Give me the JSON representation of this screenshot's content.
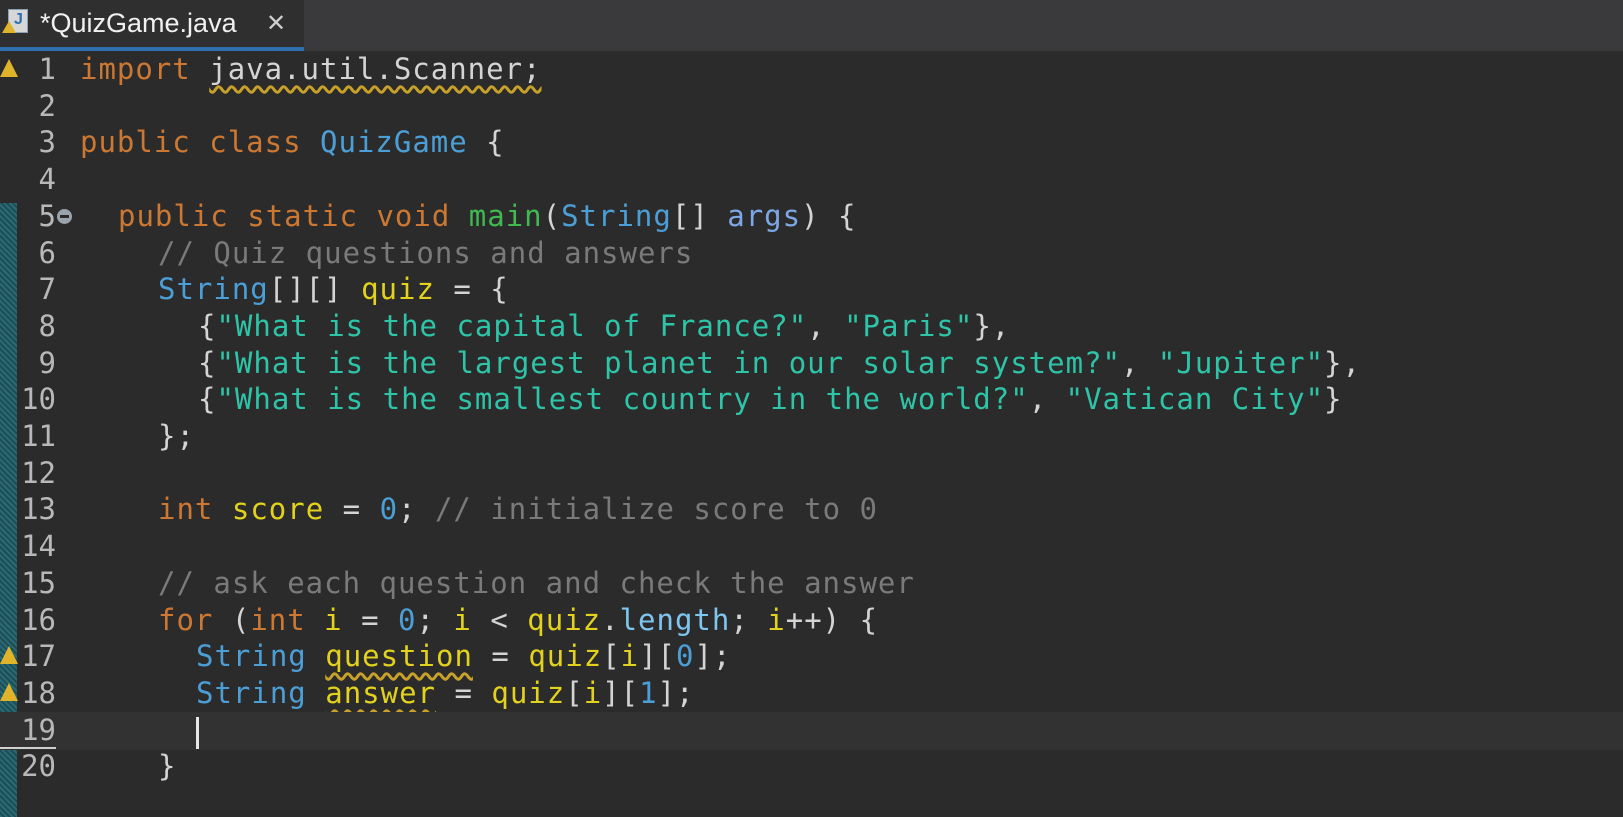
{
  "tab": {
    "title": "*QuizGame.java",
    "close": "✕",
    "icon": "java-file-warning-icon"
  },
  "editor": {
    "lines": [
      {
        "n": "1",
        "indent": 80,
        "tokens": [
          [
            "import",
            "kw"
          ],
          [
            " ",
            ""
          ],
          [
            "java.util.Scanner;",
            "sq"
          ]
        ],
        "warning": true
      },
      {
        "n": "2",
        "indent": 80,
        "tokens": []
      },
      {
        "n": "3",
        "indent": 80,
        "tokens": [
          [
            "public",
            "kw"
          ],
          [
            " ",
            ""
          ],
          [
            "class",
            "kw"
          ],
          [
            " ",
            ""
          ],
          [
            "QuizGame",
            "ty"
          ],
          [
            " {",
            ""
          ]
        ]
      },
      {
        "n": "4",
        "indent": 80,
        "tokens": []
      },
      {
        "n": "5",
        "indent": 118,
        "tokens": [
          [
            "public",
            "kw"
          ],
          [
            " ",
            ""
          ],
          [
            "static",
            "kw"
          ],
          [
            " ",
            ""
          ],
          [
            "void",
            "kw"
          ],
          [
            " ",
            ""
          ],
          [
            "main",
            "fn"
          ],
          [
            "(",
            ""
          ],
          [
            "String",
            "ty"
          ],
          [
            "[] ",
            ""
          ],
          [
            "args",
            "ar"
          ],
          [
            ") {",
            ""
          ]
        ],
        "fold": true
      },
      {
        "n": "6",
        "indent": 158,
        "tokens": [
          [
            "// Quiz questions and answers",
            "cm"
          ]
        ]
      },
      {
        "n": "7",
        "indent": 158,
        "tokens": [
          [
            "String",
            "ty"
          ],
          [
            "[][] ",
            ""
          ],
          [
            "quiz",
            "va"
          ],
          [
            " = {",
            ""
          ]
        ]
      },
      {
        "n": "8",
        "indent": 198,
        "tokens": [
          [
            "{",
            ""
          ],
          [
            "\"What is the capital of France?\"",
            "st"
          ],
          [
            ", ",
            ""
          ],
          [
            "\"Paris\"",
            "st"
          ],
          [
            "},",
            ""
          ]
        ]
      },
      {
        "n": "9",
        "indent": 198,
        "tokens": [
          [
            "{",
            ""
          ],
          [
            "\"What is the largest planet in our solar system?\"",
            "st"
          ],
          [
            ", ",
            ""
          ],
          [
            "\"Jupiter\"",
            "st"
          ],
          [
            "},",
            ""
          ]
        ]
      },
      {
        "n": "10",
        "indent": 198,
        "tokens": [
          [
            "{",
            ""
          ],
          [
            "\"What is the smallest country in the world?\"",
            "st"
          ],
          [
            ", ",
            ""
          ],
          [
            "\"Vatican City\"",
            "st"
          ],
          [
            "}",
            ""
          ]
        ]
      },
      {
        "n": "11",
        "indent": 158,
        "tokens": [
          [
            "};",
            ""
          ]
        ]
      },
      {
        "n": "12",
        "indent": 80,
        "tokens": []
      },
      {
        "n": "13",
        "indent": 158,
        "tokens": [
          [
            "int",
            "kw"
          ],
          [
            " ",
            ""
          ],
          [
            "score",
            "va"
          ],
          [
            " = ",
            ""
          ],
          [
            "0",
            "nu"
          ],
          [
            "; ",
            ""
          ],
          [
            "// initialize score to 0",
            "cm"
          ]
        ]
      },
      {
        "n": "14",
        "indent": 80,
        "tokens": []
      },
      {
        "n": "15",
        "indent": 158,
        "tokens": [
          [
            "// ask each question and check the answer",
            "cm"
          ]
        ]
      },
      {
        "n": "16",
        "indent": 158,
        "tokens": [
          [
            "for",
            "kw"
          ],
          [
            " (",
            ""
          ],
          [
            "int",
            "kw"
          ],
          [
            " ",
            ""
          ],
          [
            "i",
            "va"
          ],
          [
            " = ",
            ""
          ],
          [
            "0",
            "nu"
          ],
          [
            "; ",
            ""
          ],
          [
            "i",
            "va"
          ],
          [
            " < ",
            ""
          ],
          [
            "quiz",
            "va"
          ],
          [
            ".",
            ""
          ],
          [
            "length",
            "fd"
          ],
          [
            "; ",
            ""
          ],
          [
            "i",
            "va"
          ],
          [
            "++) {",
            ""
          ]
        ]
      },
      {
        "n": "17",
        "indent": 196,
        "tokens": [
          [
            "String",
            "ty"
          ],
          [
            " ",
            ""
          ],
          [
            "question",
            "va sq"
          ],
          [
            " = ",
            ""
          ],
          [
            "quiz",
            "va"
          ],
          [
            "[",
            ""
          ],
          [
            "i",
            "va"
          ],
          [
            "][",
            ""
          ],
          [
            "0",
            "nu"
          ],
          [
            "];",
            ""
          ]
        ],
        "warning": true
      },
      {
        "n": "18",
        "indent": 196,
        "tokens": [
          [
            "String",
            "ty"
          ],
          [
            " ",
            ""
          ],
          [
            "answer",
            "va sq"
          ],
          [
            " = ",
            ""
          ],
          [
            "quiz",
            "va"
          ],
          [
            "[",
            ""
          ],
          [
            "i",
            "va"
          ],
          [
            "][",
            ""
          ],
          [
            "1",
            "nu"
          ],
          [
            "];",
            ""
          ]
        ],
        "warning": true
      },
      {
        "n": "19",
        "indent": 196,
        "tokens": [],
        "current": true
      },
      {
        "n": "20",
        "indent": 158,
        "tokens": [
          [
            "}",
            ""
          ]
        ]
      }
    ]
  }
}
